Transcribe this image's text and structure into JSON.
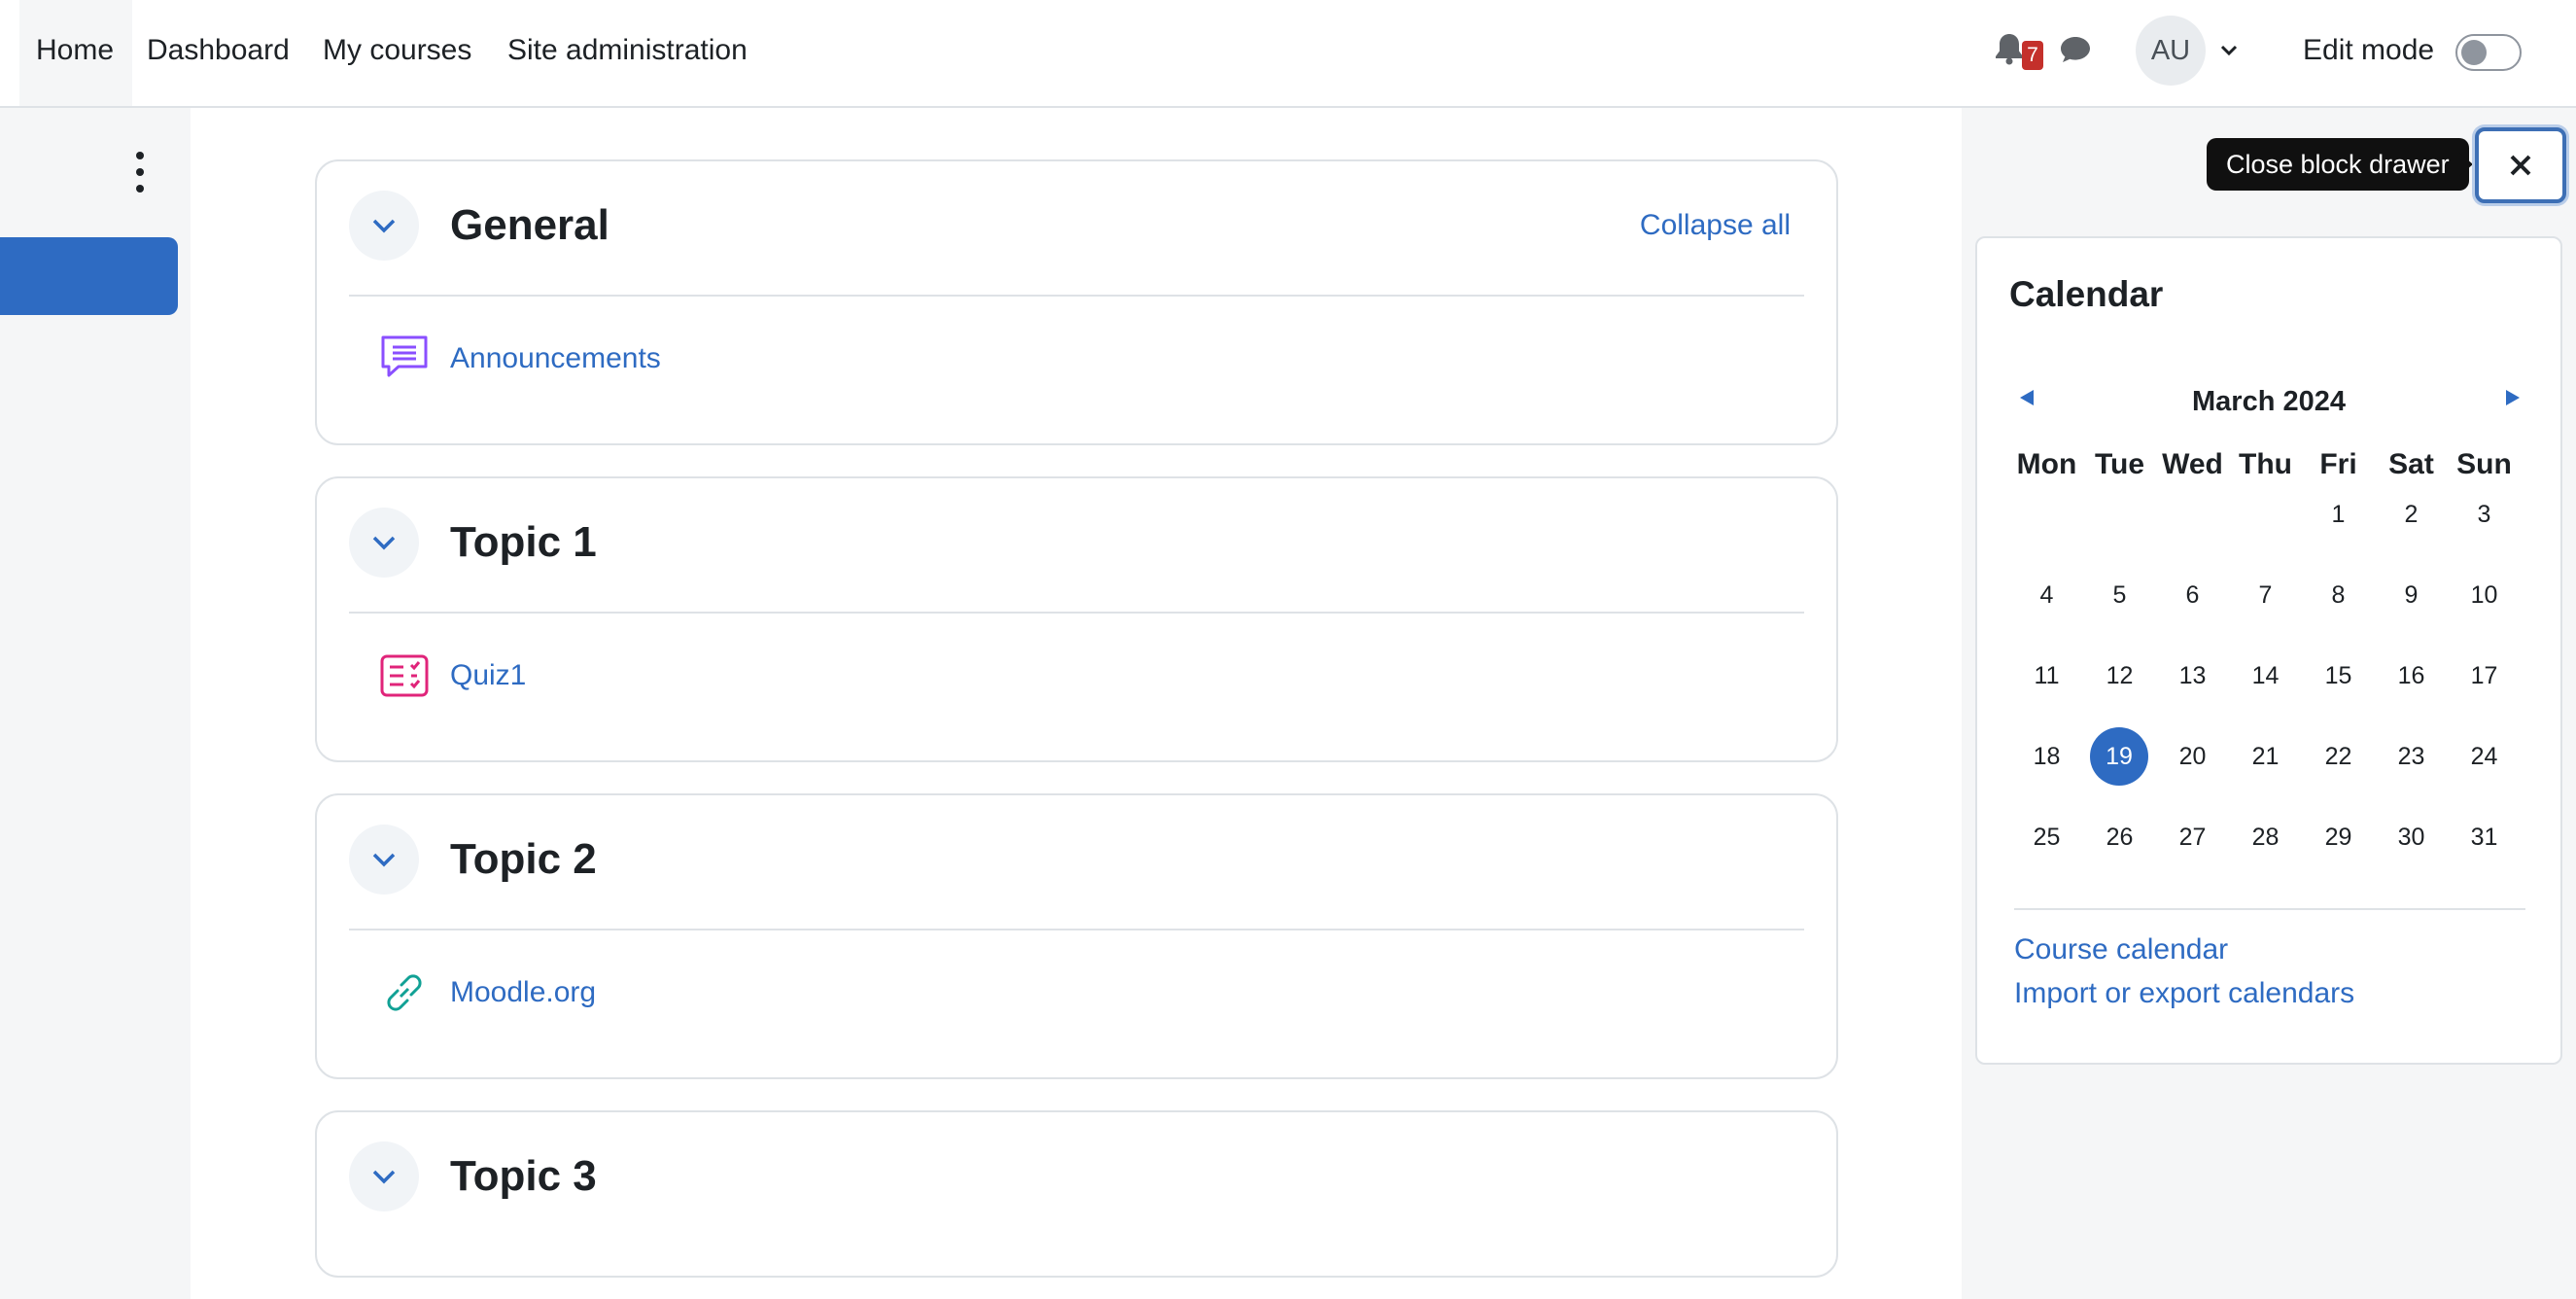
{
  "nav": {
    "tabs": [
      "Home",
      "Dashboard",
      "My courses",
      "Site administration"
    ],
    "notification_count": "7",
    "avatar_initials": "AU",
    "edit_mode_label": "Edit mode",
    "edit_mode_on": false
  },
  "sections": [
    {
      "title": "General",
      "collapse_all": "Collapse all",
      "activity": {
        "label": "Announcements",
        "icon": "forum-icon",
        "color": "#8a4fff"
      }
    },
    {
      "title": "Topic 1",
      "activity": {
        "label": "Quiz1",
        "icon": "quiz-icon",
        "color": "#e0247a"
      }
    },
    {
      "title": "Topic 2",
      "activity": {
        "label": "Moodle.org",
        "icon": "url-link-icon",
        "color": "#11a195"
      }
    },
    {
      "title": "Topic 3"
    }
  ],
  "block_drawer": {
    "close_tooltip": "Close block drawer"
  },
  "calendar": {
    "title": "Calendar",
    "month": "March 2024",
    "weekdays": [
      "Mon",
      "Tue",
      "Wed",
      "Thu",
      "Fri",
      "Sat",
      "Sun"
    ],
    "first_weekday_index": 4,
    "days_in_month": 31,
    "today": 19,
    "links": [
      "Course calendar",
      "Import or export calendars"
    ]
  },
  "colors": {
    "accent": "#2e6bc2",
    "badge": "#c4302b"
  }
}
